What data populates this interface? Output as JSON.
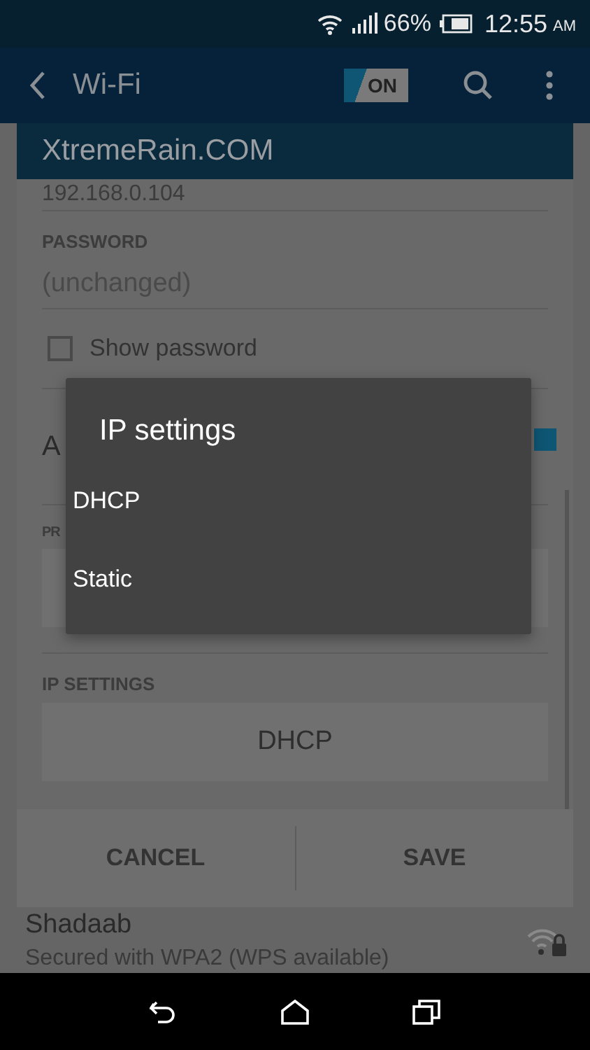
{
  "status_bar": {
    "battery": "66%",
    "time": "12:55",
    "meridiem": "AM"
  },
  "app_bar": {
    "title": "Wi-Fi",
    "switch": {
      "label": "ON",
      "on": true
    }
  },
  "dialog": {
    "title": "XtremeRain.COM",
    "ip_address": "192.168.0.104",
    "password": {
      "label": "PASSWORD",
      "placeholder": "(unchanged)"
    },
    "show_password": {
      "label": "Show password",
      "checked": false
    },
    "advanced": {
      "label": "A",
      "checked": true
    },
    "proxy": {
      "label": "PR"
    },
    "ip_settings": {
      "label": "IP SETTINGS",
      "value": "DHCP"
    },
    "buttons": [
      "CANCEL",
      "SAVE"
    ]
  },
  "popup": {
    "title": "IP settings",
    "options": [
      "DHCP",
      "Static"
    ]
  },
  "network": {
    "name": "Shadaab",
    "detail": "Secured with WPA2 (WPS available)"
  }
}
